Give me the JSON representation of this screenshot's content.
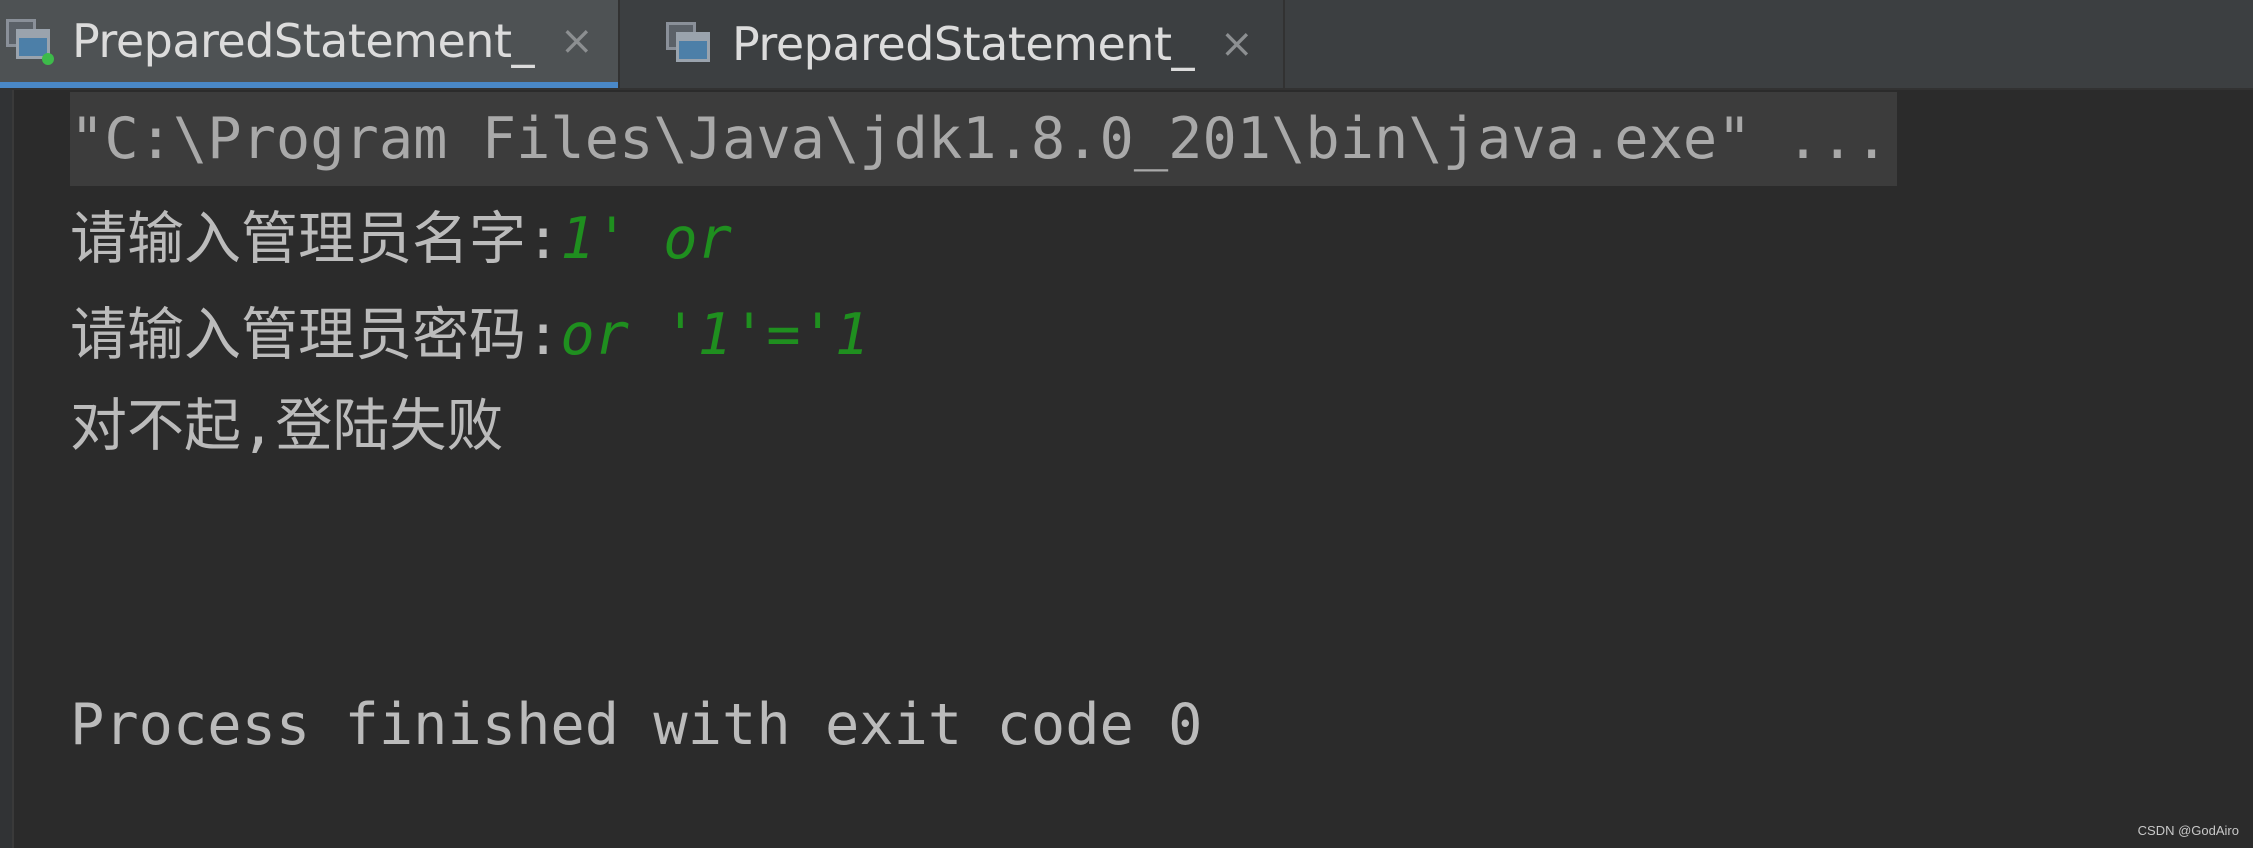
{
  "tabs": [
    {
      "label": "PreparedStatement_",
      "close": "×",
      "icon": "run-config-icon",
      "active": true
    },
    {
      "label": "PreparedStatement_",
      "close": "×",
      "icon": "run-config-icon",
      "active": false
    }
  ],
  "console": {
    "command": "\"C:\\Program Files\\Java\\jdk1.8.0_201\\bin\\java.exe\" ...",
    "prompt_name": "请输入管理员名字:",
    "input_name": "1' or",
    "prompt_password": "请输入管理员密码:",
    "input_password": "or '1'='1",
    "result": "对不起,登陆失败",
    "exit_message": "Process finished with exit code 0"
  },
  "colors": {
    "background": "#2b2b2b",
    "tabbar": "#3c3f41",
    "active_tab": "#4e5254",
    "text": "#bbbbbb",
    "user_input": "#1f8f1f"
  },
  "watermark": "CSDN @GodAiro"
}
